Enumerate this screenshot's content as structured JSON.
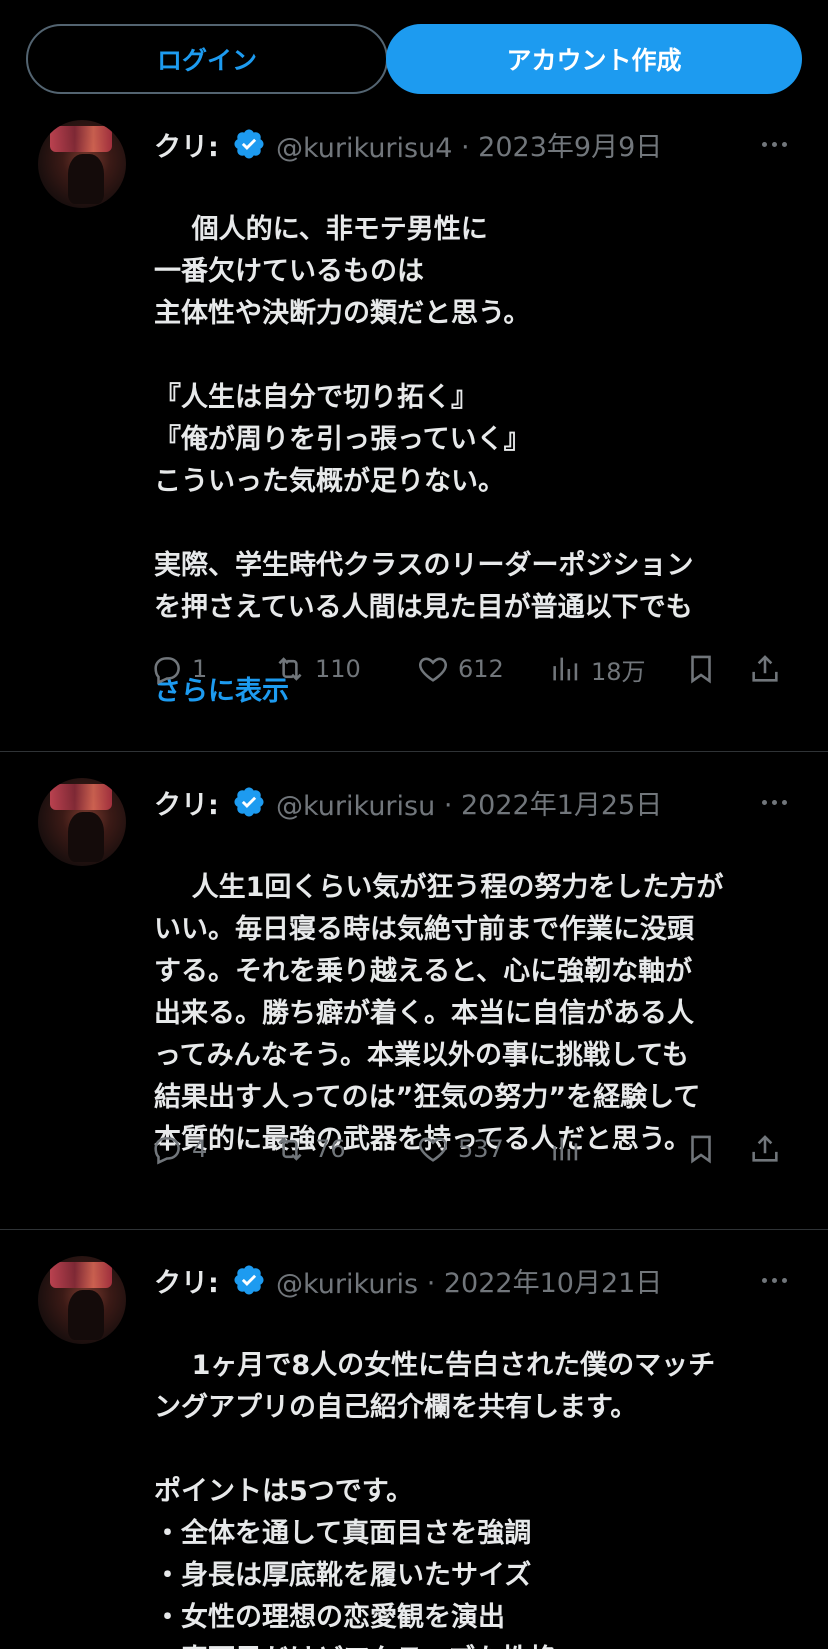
{
  "topbar": {
    "login_label": "ログイン",
    "signup_label": "アカウント作成"
  },
  "colors": {
    "accent": "#1d9bf0",
    "secondary_text": "#71767b",
    "background": "#000000"
  },
  "tweets": [
    {
      "name": "クリ:",
      "handle": "@kurikurisu4",
      "date": "2023年9月9日",
      "text": "個人的に、非モテ男性に\n一番欠けているものは\n主体性や決断力の類だと思う。\n\n『人生は自分で切り拓く』\n『俺が周りを引っ張っていく』\nこういった気概が足りない。\n\n実際、学生時代クラスのリーダーポジション\nを押さえている人間は見た目が普通以下でも",
      "show_more": "さらに表示",
      "replies": "1",
      "retweets": "110",
      "likes": "612",
      "views": "18万"
    },
    {
      "name": "クリ:",
      "handle": "@kurikurisu",
      "date": "2022年1月25日",
      "text": "人生1回くらい気が狂う程の努力をした方が\nいい。毎日寝る時は気絶寸前まで作業に没頭\nする。それを乗り越えると、心に強靭な軸が\n出来る。勝ち癖が着く。本当に自信がある人\nってみんなそう。本業以外の事に挑戦しても\n結果出す人ってのは”狂気の努力”を経験して\n本質的に最強の武器を持ってる人だと思う。",
      "replies": "4",
      "retweets": "76",
      "likes": "537",
      "views": ""
    },
    {
      "name": "クリ:",
      "handle": "@kurikuris",
      "date": "2022年10月21日",
      "text": "1ヶ月で8人の女性に告白された僕のマッチ\nングアプリの自己紹介欄を共有します。\n\nポイントは5つです。\n・全体を通して真面目さを強調\n・身長は厚底靴を履いたサイズ\n・女性の理想の恋愛観を演出\n・真面目だけどアクティブな性格"
    }
  ]
}
